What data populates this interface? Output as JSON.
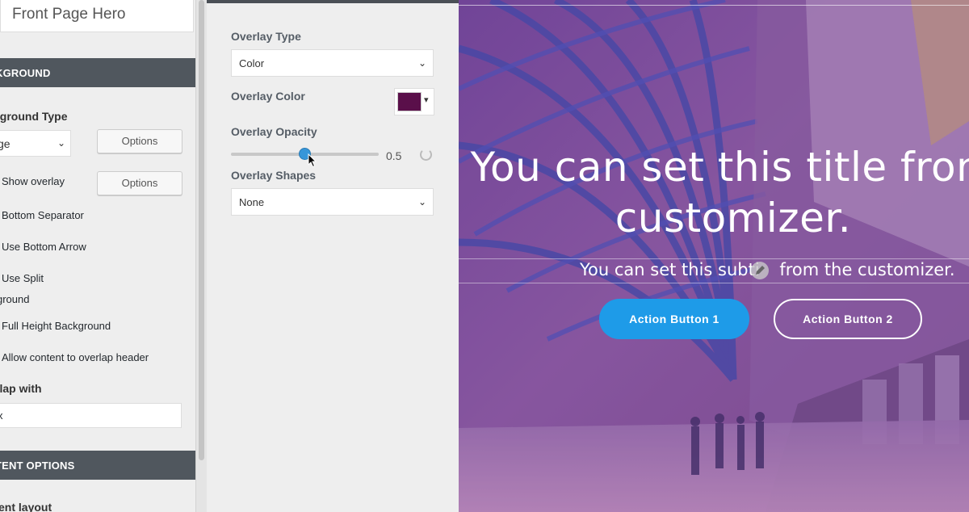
{
  "left_panel": {
    "hero_name": "Front Page Hero",
    "section_background": "KGROUND",
    "background_type_label": "kground Type",
    "background_type_value": "ge",
    "options_button_1": "Options",
    "show_overlay_label": "Show overlay",
    "options_button_2": "Options",
    "bottom_separator_label": "Bottom Separator",
    "bottom_arrow_label": "Use Bottom Arrow",
    "use_split_label": "Use Split",
    "split_cont_label": "ground",
    "full_height_label": "Full Height Background",
    "allow_overlap_label": "Allow content to overlap header",
    "overlap_with_label": "rlap with",
    "overlap_value": "x",
    "section_content": "TENT OPTIONS",
    "content_layout_label": "ent layout"
  },
  "mid_panel": {
    "overlay_type_label": "Overlay Type",
    "overlay_type_value": "Color",
    "overlay_color_label": "Overlay Color",
    "overlay_color": "#5a0f4a",
    "overlay_opacity_label": "Overlay Opacity",
    "overlay_opacity_value": "0.5",
    "overlay_opacity": 0.5,
    "overlay_shapes_label": "Overlay Shapes",
    "overlay_shapes_value": "None"
  },
  "preview": {
    "title_line1": "You can set this title from",
    "title_line2": "customizer.",
    "subtitle_left": "You can set this subti",
    "subtitle_right": " from the customizer.",
    "button1": "Action Button 1",
    "button2": "Action Button 2",
    "accent_color": "#1e9be8"
  }
}
